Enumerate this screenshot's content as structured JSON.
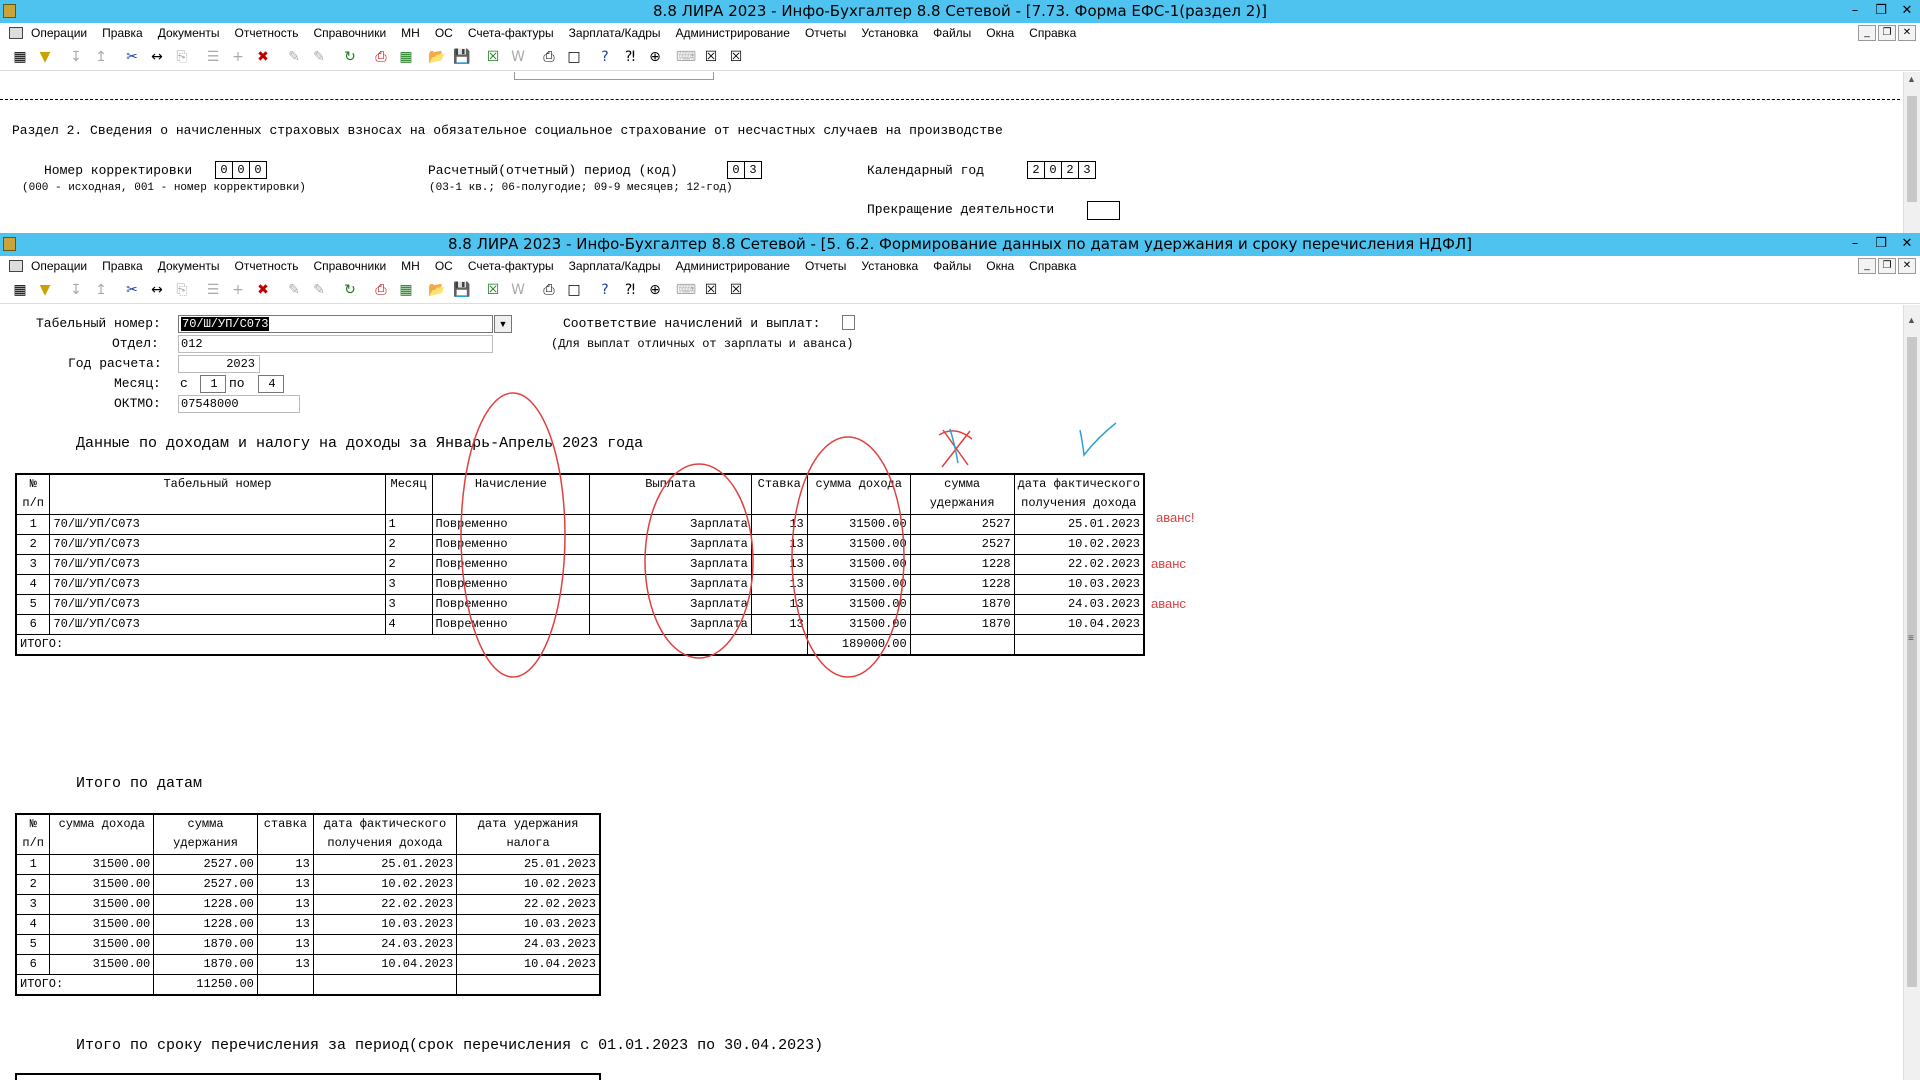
{
  "window1": {
    "title": "8.8 ЛИРА 2023 - Инфо-Бухгалтер 8.8 Сетевой - [7.73.    Форма ЕФС-1(раздел 2)]",
    "section_title": "Раздел 2. Сведения о начисленных страховых взносах на обязательное социальное страхование от несчастных случаев на производстве",
    "correction_label": "Номер корректировки",
    "correction_digits": [
      "0",
      "0",
      "0"
    ],
    "correction_hint": "(000 - исходная, 001 - номер  корректировки)",
    "period_label": "Расчетный(отчетный) период (код)",
    "period_digits": [
      "0",
      "3"
    ],
    "period_hint": "(03-1 кв.; 06-полугодие; 09-9 месяцев; 12-год)",
    "year_label": "Календарный год",
    "year_digits": [
      "2",
      "0",
      "2",
      "3"
    ],
    "stop_label": "Прекращение деятельности"
  },
  "window2": {
    "title": "8.8 ЛИРА 2023 - Инфо-Бухгалтер 8.8 Сетевой - [5.  6.2. Формирование данных по датам удержания и сроку перечисления НДФЛ]"
  },
  "menu": [
    "Операции",
    "Правка",
    "Документы",
    "Отчетность",
    "Справочники",
    "МН",
    "ОС",
    "Счета-фактуры",
    "Зарплата/Кадры",
    "Администрирование",
    "Отчеты",
    "Установка",
    "Файлы",
    "Окна",
    "Справка"
  ],
  "form": {
    "tab_label": "Табельный номер:",
    "tab_value": "70/Ш/УП/С073",
    "dept_label": "Отдел:",
    "dept_value": "012",
    "year_label": "Год расчета:",
    "year_value": "2023",
    "month_label": "Месяц:",
    "month_from_label": "с",
    "month_from": "1",
    "month_to_label": "по",
    "month_to": "4",
    "oktmo_label": "ОКТМО:",
    "oktmo_value": "07548000",
    "match_label": "Соответствие начислений и выплат:",
    "match_hint": "(Для выплат отличных от зарплаты и аванса)"
  },
  "table1": {
    "heading": "Данные по доходам и налогу на доходы за Январь-Апрель 2023 года",
    "headers": [
      "№\nп/п",
      "Табельный номер",
      "Месяц",
      "Начисление",
      "Выплата",
      "Ставка",
      "сумма дохода",
      "сумма\nудержания",
      "дата фактического\nполучения дохода"
    ],
    "rows": [
      [
        "1",
        "70/Ш/УП/С073",
        "1",
        "Повременно",
        "Зарплата",
        "13",
        "31500.00",
        "2527",
        "25.01.2023"
      ],
      [
        "2",
        "70/Ш/УП/С073",
        "2",
        "Повременно",
        "Зарплата",
        "13",
        "31500.00",
        "2527",
        "10.02.2023"
      ],
      [
        "3",
        "70/Ш/УП/С073",
        "2",
        "Повременно",
        "Зарплата",
        "13",
        "31500.00",
        "1228",
        "22.02.2023"
      ],
      [
        "4",
        "70/Ш/УП/С073",
        "3",
        "Повременно",
        "Зарплата",
        "13",
        "31500.00",
        "1228",
        "10.03.2023"
      ],
      [
        "5",
        "70/Ш/УП/С073",
        "3",
        "Повременно",
        "Зарплата",
        "13",
        "31500.00",
        "1870",
        "24.03.2023"
      ],
      [
        "6",
        "70/Ш/УП/С073",
        "4",
        "Повременно",
        "Зарплата",
        "13",
        "31500.00",
        "1870",
        "10.04.2023"
      ]
    ],
    "total_label": "ИТОГО:",
    "total_income": "189000.00"
  },
  "table2": {
    "heading": "Итого по датам",
    "headers": [
      "№\nп/п",
      "сумма дохода",
      "сумма\nудержания",
      "ставка",
      "дата фактического\nполучения дохода",
      "дата удержания\nналога"
    ],
    "rows": [
      [
        "1",
        "31500.00",
        "2527.00",
        "13",
        "25.01.2023",
        "25.01.2023"
      ],
      [
        "2",
        "31500.00",
        "2527.00",
        "13",
        "10.02.2023",
        "10.02.2023"
      ],
      [
        "3",
        "31500.00",
        "1228.00",
        "13",
        "22.02.2023",
        "22.02.2023"
      ],
      [
        "4",
        "31500.00",
        "1228.00",
        "13",
        "10.03.2023",
        "10.03.2023"
      ],
      [
        "5",
        "31500.00",
        "1870.00",
        "13",
        "24.03.2023",
        "24.03.2023"
      ],
      [
        "6",
        "31500.00",
        "1870.00",
        "13",
        "10.04.2023",
        "10.04.2023"
      ]
    ],
    "total_label": "ИТОГО:",
    "total_withheld": "11250.00"
  },
  "table3": {
    "heading": "Итого по сроку перечисления за период(срок перечисления с 01.01.2023 по 30.04.2023)"
  },
  "annotations": {
    "note1": "аванс!",
    "note2": "аванс",
    "note3": "аванс",
    "annotation_color": "#e04040",
    "check_color": "#2aa0d8",
    "titlebar_color": "#4fc3f0"
  }
}
